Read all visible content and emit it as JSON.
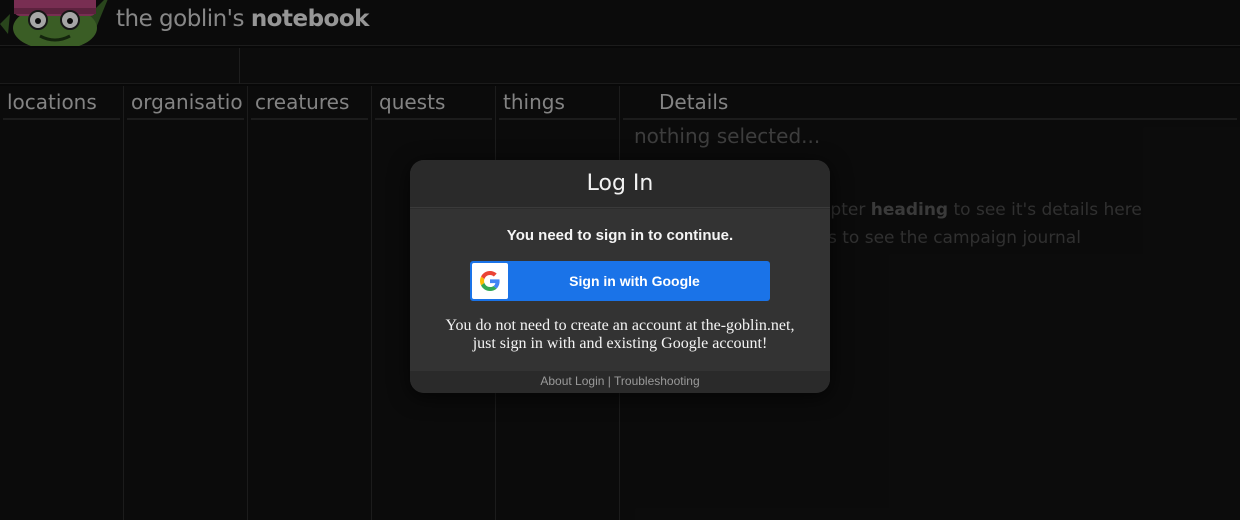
{
  "header": {
    "brand_prefix": "the goblin's",
    "brand_bold": "notebook"
  },
  "columns": [
    {
      "label": "locations"
    },
    {
      "label": "organisation"
    },
    {
      "label": "creatures"
    },
    {
      "label": "quests"
    },
    {
      "label": "things"
    }
  ],
  "details": {
    "label": "Details",
    "empty_text": "nothing selected...",
    "hint_1_prefix": "apter",
    "hint_1_bold": "heading",
    "hint_1_suffix": "to see it's details here",
    "hint_2": "s to see the campaign journal"
  },
  "modal": {
    "title": "Log In",
    "need_text": "You need to sign in to continue.",
    "google_button": "Sign in with Google",
    "note_line_1": "You do not need to create an account at the-goblin.net,",
    "note_line_2": "just sign in with and existing Google account!",
    "footer_about": "About Login",
    "footer_sep": "|",
    "footer_trouble": "Troubleshooting"
  },
  "colors": {
    "google_blue": "#1a73e8",
    "background": "#0d0d0d",
    "modal": "#2c2c2c"
  }
}
